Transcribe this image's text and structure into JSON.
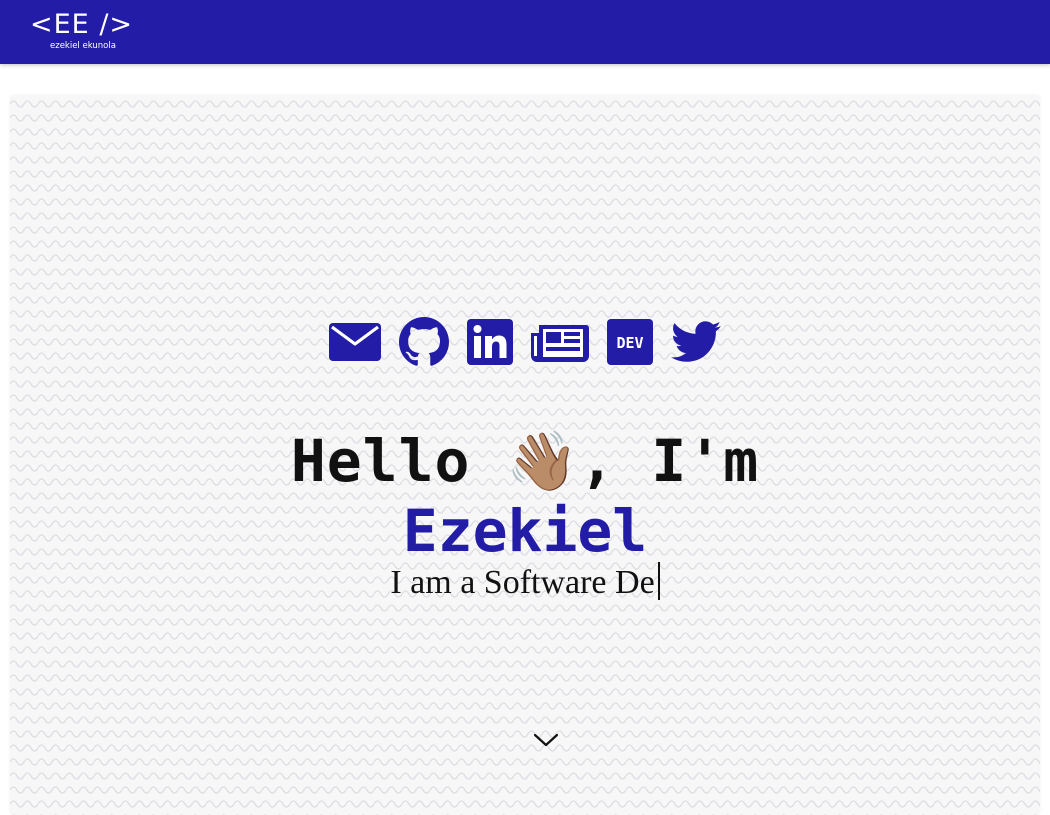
{
  "header": {
    "logo_mark": "<EE />",
    "logo_subtitle": "ezekiel ekunola",
    "bar_color": "#221ca6"
  },
  "hero": {
    "social_links": [
      {
        "name": "email",
        "icon": "envelope-icon"
      },
      {
        "name": "github",
        "icon": "github-icon"
      },
      {
        "name": "linkedin",
        "icon": "linkedin-icon"
      },
      {
        "name": "blog",
        "icon": "newspaper-icon"
      },
      {
        "name": "dev",
        "icon": "dev-icon",
        "icon_text": "DEV"
      },
      {
        "name": "twitter",
        "icon": "twitter-icon"
      }
    ],
    "greeting": "Hello 👋🏽, I'm",
    "name": "Ezekiel",
    "tagline": "I am a Software De",
    "scroll_icon": "chevron-down-icon",
    "accent_color": "#221ca6"
  }
}
